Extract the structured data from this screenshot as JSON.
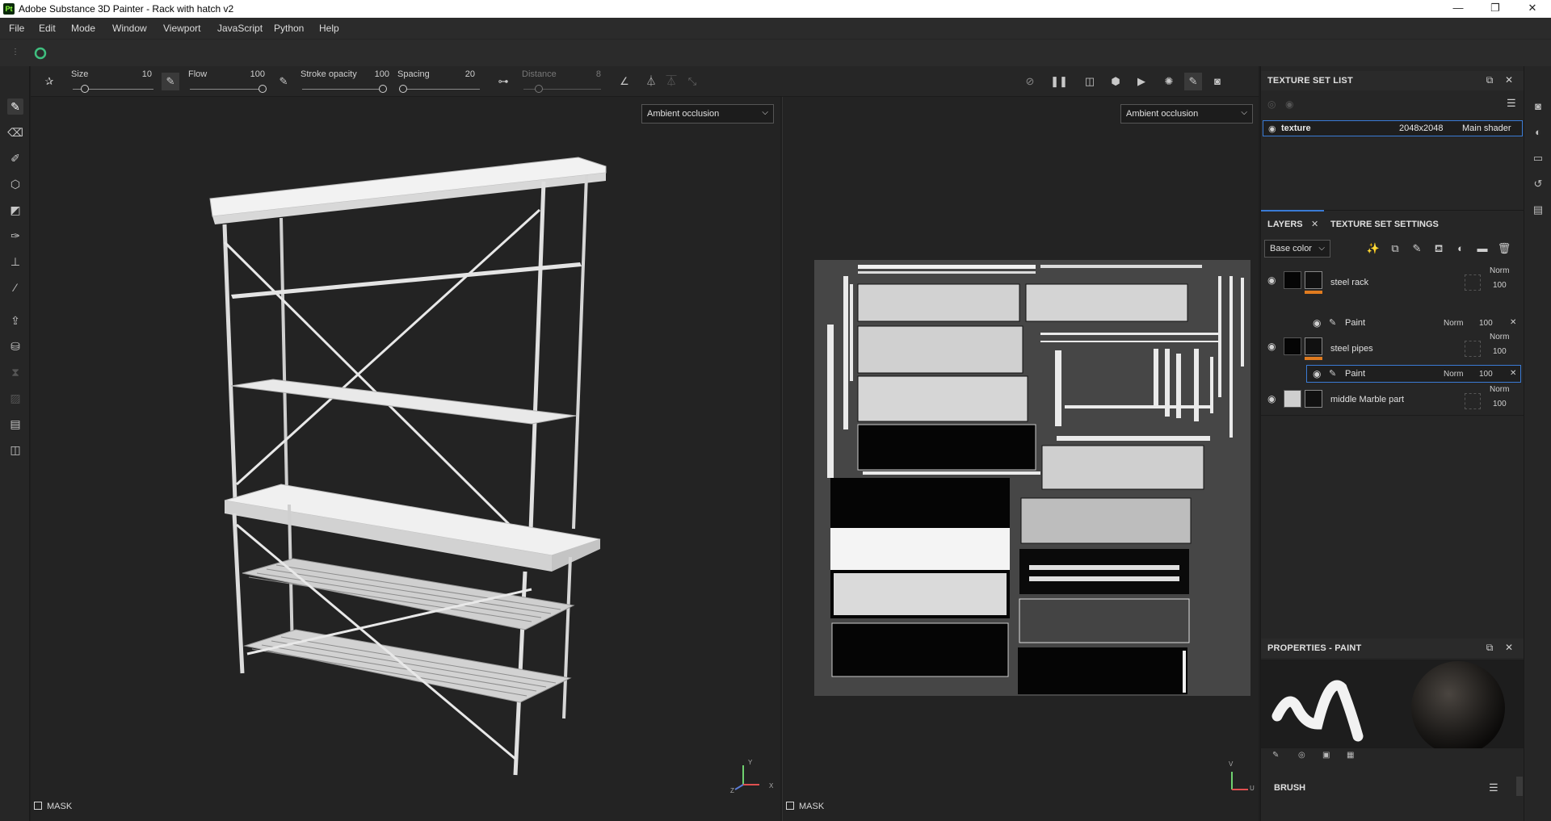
{
  "window": {
    "app_icon": "Pt",
    "title": "Adobe Substance 3D Painter - Rack with hatch v2",
    "controls": [
      "minimize-icon",
      "restore-icon",
      "close-icon"
    ]
  },
  "menu": [
    "File",
    "Edit",
    "Mode",
    "Window",
    "Viewport",
    "JavaScript",
    "Python",
    "Help"
  ],
  "toolbar": {
    "size_label": "Size",
    "size_value": "10",
    "size_level": 0.15,
    "flow_label": "Flow",
    "flow_value": "100",
    "flow_level": 1.0,
    "stroke_label": "Stroke opacity",
    "stroke_value": "100",
    "stroke_level": 1.0,
    "spacing_label": "Spacing",
    "spacing_value": "20",
    "spacing_level": 0.05,
    "distance_label": "Distance",
    "distance_value": "8",
    "distance_level": 0.2
  },
  "viewport_left": {
    "mode": "Ambient occlusion",
    "mask_label": "MASK",
    "axis_y": "Y",
    "axis_x": "X",
    "axis_z": "Z"
  },
  "viewport_right": {
    "mode": "Ambient occlusion",
    "mask_label": "MASK",
    "axis_v": "V",
    "axis_u": "U"
  },
  "texture_set_list": {
    "title": "TEXTURE SET LIST",
    "items": [
      {
        "name": "texture",
        "resolution": "2048x2048",
        "shader": "Main shader"
      }
    ]
  },
  "layers_panel": {
    "tab_layers": "LAYERS",
    "tab_settings": "TEXTURE SET SETTINGS",
    "channel": "Base color",
    "layers": [
      {
        "name": "steel rack",
        "blend": "Norm",
        "opacity": "100",
        "effect": {
          "name": "Paint",
          "blend": "Norm",
          "opacity": "100"
        }
      },
      {
        "name": "steel pipes",
        "blend": "Norm",
        "opacity": "100",
        "effect": {
          "name": "Paint",
          "blend": "Norm",
          "opacity": "100"
        }
      },
      {
        "name": "middle Marble part",
        "blend": "Norm",
        "opacity": "100"
      }
    ]
  },
  "properties": {
    "title": "PROPERTIES - PAINT",
    "brush_label": "BRUSH"
  },
  "colors": {
    "accent_blue": "#3a7bd5",
    "orange": "#e07b1f",
    "panel": "#262626",
    "viewport": "#232323"
  }
}
